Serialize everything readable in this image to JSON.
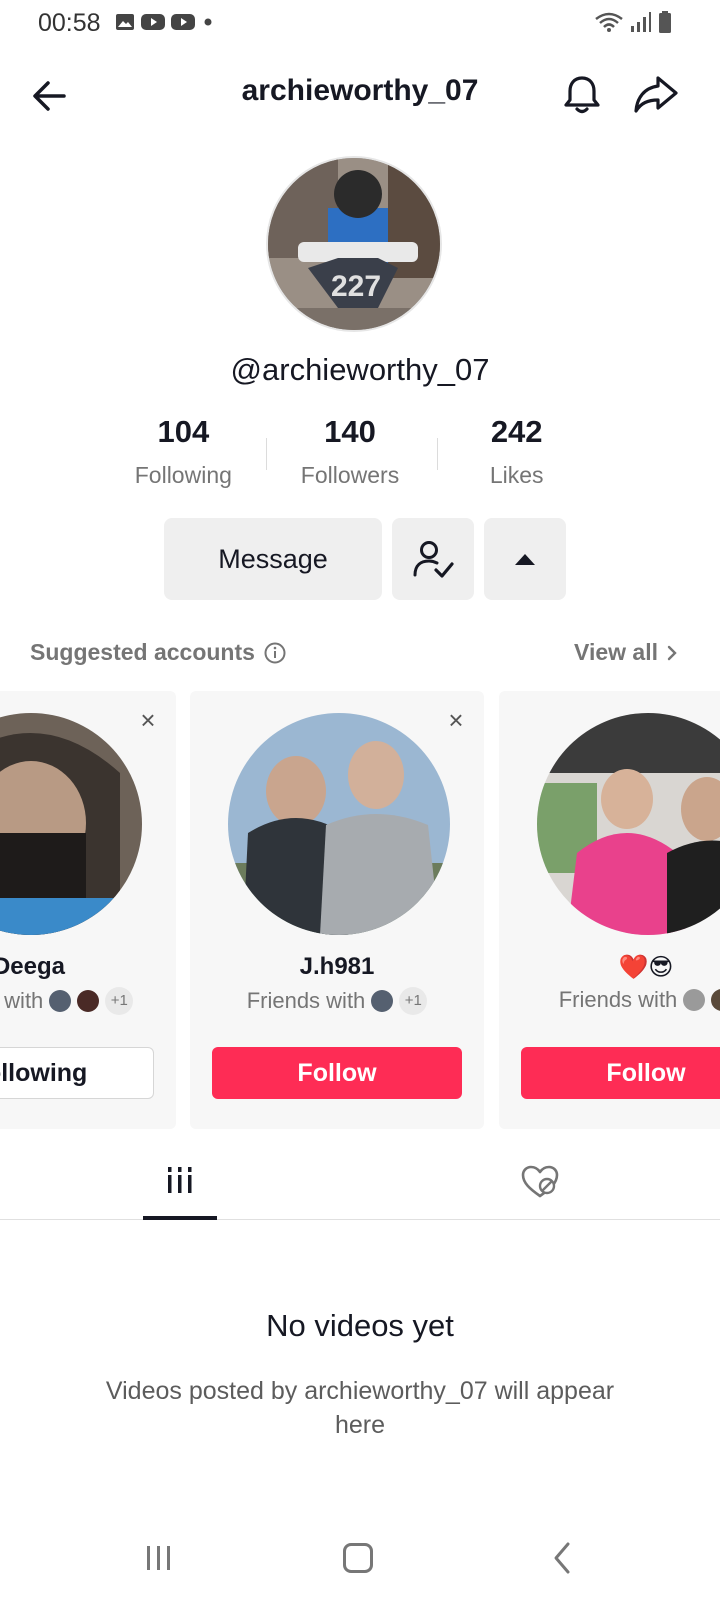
{
  "status_bar": {
    "time": "00:58",
    "icons_left": [
      "image-icon",
      "youtube-icon",
      "youtube-icon",
      "dot-icon"
    ],
    "icons_right": [
      "wifi-icon",
      "signal-icon",
      "battery-icon"
    ]
  },
  "header": {
    "title": "archieworthy_07",
    "back_icon": "back-arrow-icon",
    "bell_icon": "bell-icon",
    "share_icon": "share-icon"
  },
  "profile": {
    "handle": "@archieworthy_07",
    "stats": [
      {
        "value": "104",
        "label": "Following"
      },
      {
        "value": "140",
        "label": "Followers"
      },
      {
        "value": "242",
        "label": "Likes"
      }
    ]
  },
  "actions": {
    "message_label": "Message",
    "friends_icon": "person-check-icon",
    "toggle_icon": "triangle-up-icon"
  },
  "suggested": {
    "title": "Suggested accounts",
    "info_icon": "info-icon",
    "view_all": "View all",
    "cards": [
      {
        "name": "Deega",
        "friends_text": "Friends with",
        "extra": "+1",
        "button": "Following"
      },
      {
        "name": "J.h981",
        "friends_text": "Friends with",
        "extra": "+1",
        "button": "Follow"
      },
      {
        "name": "❤️😎",
        "friends_text": "Friends with",
        "extra": "",
        "button": "Follow"
      }
    ]
  },
  "tabs": {
    "videos_icon": "grid-icon",
    "liked_icon": "hidden-heart-icon"
  },
  "empty_state": {
    "title": "No videos yet",
    "description": "Videos posted by archieworthy_07 will appear here"
  },
  "colors": {
    "accent": "#fe2c55",
    "text": "#161823",
    "muted": "#757575"
  }
}
